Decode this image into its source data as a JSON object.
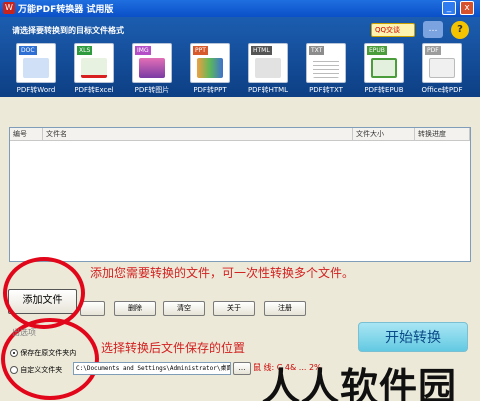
{
  "titlebar": {
    "title": "万能PDF转换器 试用版",
    "min": "_",
    "close": "x"
  },
  "header": {
    "prompt": "请选择要转换到的目标文件格式",
    "qq_label": "QQ交谈",
    "chat_glyph": "…",
    "help_glyph": "?"
  },
  "formats": [
    {
      "tag": "DOC",
      "label": "PDF转Word",
      "color": "#2d6fd2"
    },
    {
      "tag": "XLS",
      "label": "PDF转Excel",
      "color": "#2e9b3e"
    },
    {
      "tag": "IMG",
      "label": "PDF转图片",
      "color": "#b44fc7"
    },
    {
      "tag": "PPT",
      "label": "PDF转PPT",
      "color": "#d65a2c"
    },
    {
      "tag": "HTML",
      "label": "PDF转HTML",
      "color": "#555555"
    },
    {
      "tag": "TXT",
      "label": "PDF转TXT",
      "color": "#8c8c8c"
    },
    {
      "tag": "EPUB",
      "label": "PDF转EPUB",
      "color": "#4a9d3a"
    },
    {
      "tag": "PDF",
      "label": "Office转PDF",
      "color": "#9c9c9c"
    }
  ],
  "table": {
    "columns": [
      "编号",
      "文件名",
      "文件大小",
      "转换进度"
    ]
  },
  "annotations": {
    "add_note": "添加您需要转换的文件，可一次性转换多个文件。",
    "save_note": "选择转换后文件保存的位置"
  },
  "buttons": {
    "add": "添加文件",
    "delete": "删除",
    "clear": "清空",
    "about": "关于",
    "register": "注册",
    "browse": "…",
    "start": "开始转换"
  },
  "options": {
    "section": "出选项",
    "save_original": "保存在原文件夹内",
    "custom_folder": "自定义文件夹",
    "path": "C:\\Documents and Settings\\Administrator\\桌面"
  },
  "watermark": "人人软件园",
  "stray": "鼠  线:  C  4&  ...  2%"
}
